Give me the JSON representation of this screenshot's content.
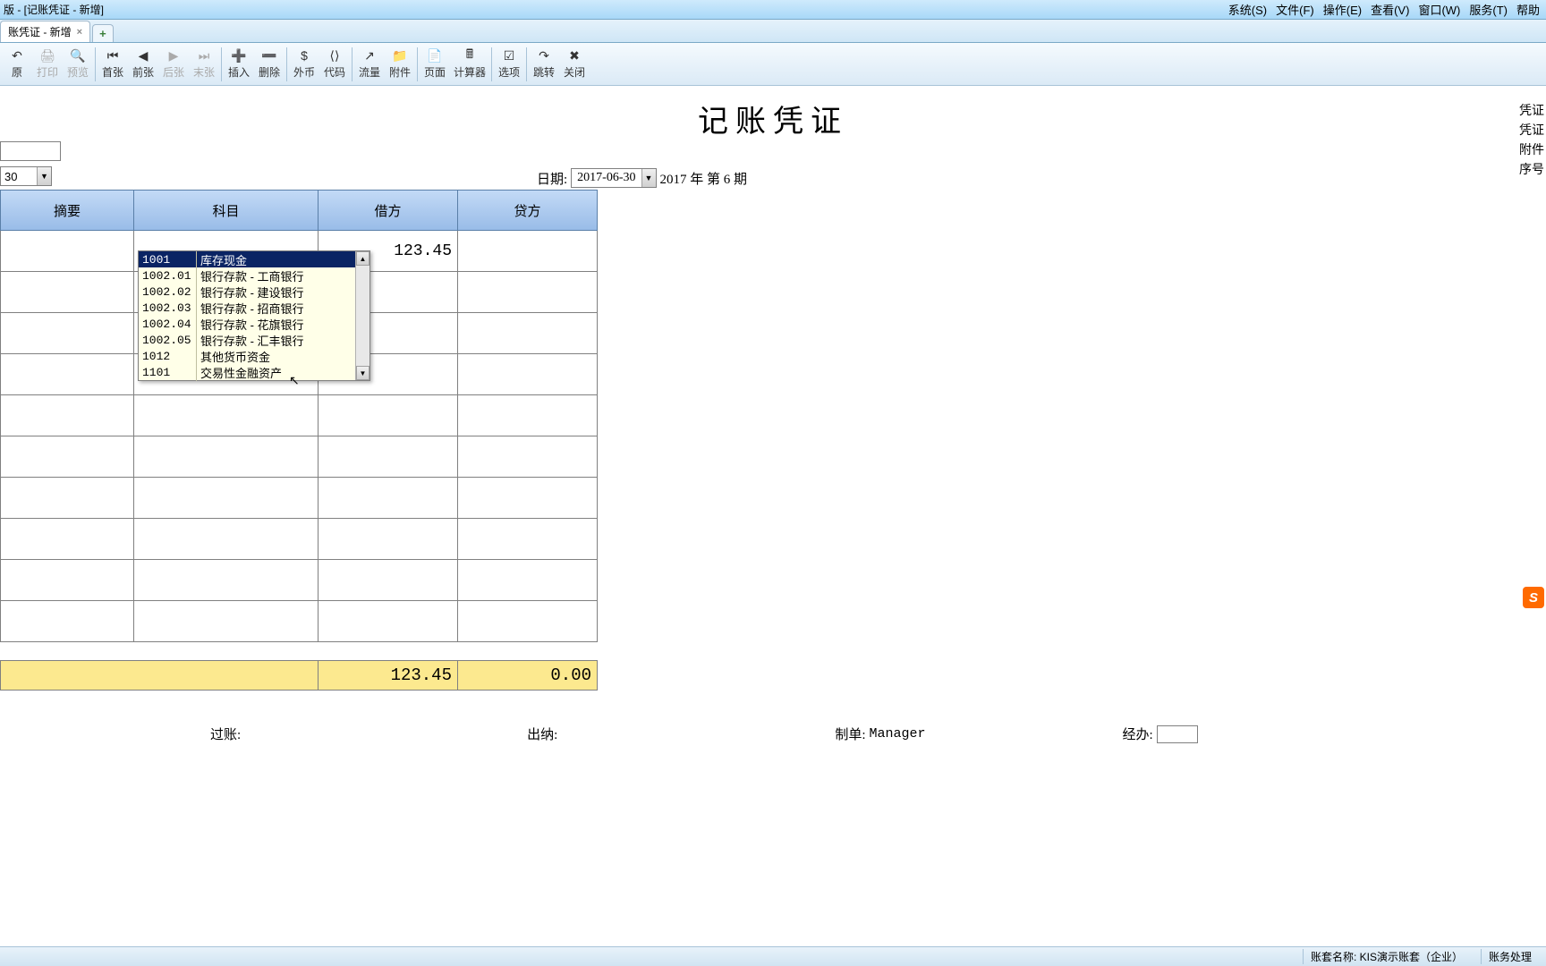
{
  "window": {
    "title": "版 - [记账凭证 - 新增]"
  },
  "menus": [
    {
      "label": "系统(S)"
    },
    {
      "label": "文件(F)"
    },
    {
      "label": "操作(E)"
    },
    {
      "label": "查看(V)"
    },
    {
      "label": "窗口(W)"
    },
    {
      "label": "服务(T)"
    },
    {
      "label": "帮助"
    }
  ],
  "tab": {
    "label": "账凭证 - 新增"
  },
  "toolbar": [
    {
      "label": "原",
      "icon": "↶",
      "group": 0
    },
    {
      "label": "打印",
      "icon": "🖨",
      "group": 0,
      "disabled": true
    },
    {
      "label": "预览",
      "icon": "🔍",
      "group": 0,
      "disabled": true
    },
    {
      "label": "首张",
      "icon": "⏮",
      "group": 1
    },
    {
      "label": "前张",
      "icon": "◀",
      "group": 1
    },
    {
      "label": "后张",
      "icon": "▶",
      "group": 1,
      "disabled": true
    },
    {
      "label": "末张",
      "icon": "⏭",
      "group": 1,
      "disabled": true
    },
    {
      "label": "插入",
      "icon": "➕",
      "group": 2
    },
    {
      "label": "删除",
      "icon": "➖",
      "group": 2
    },
    {
      "label": "外币",
      "icon": "$",
      "group": 3
    },
    {
      "label": "代码",
      "icon": "⟨⟩",
      "group": 3
    },
    {
      "label": "流量",
      "icon": "↗",
      "group": 4
    },
    {
      "label": "附件",
      "icon": "📁",
      "group": 4
    },
    {
      "label": "页面",
      "icon": "📄",
      "group": 5
    },
    {
      "label": "计算器",
      "icon": "🖩",
      "group": 5
    },
    {
      "label": "选项",
      "icon": "☑",
      "group": 6
    },
    {
      "label": "跳转",
      "icon": "↷",
      "group": 7
    },
    {
      "label": "关闭",
      "icon": "✖",
      "group": 7
    }
  ],
  "page": {
    "title": "记账凭证",
    "right_labels": [
      "凭证",
      "凭证",
      "附件",
      "序号"
    ],
    "number_select": "30",
    "date_label": "日期:",
    "date_value": "2017-06-30",
    "period_text": "2017 年 第 6 期"
  },
  "grid": {
    "headers": {
      "summary": "摘要",
      "subject": "科目",
      "debit": "借方",
      "credit": "贷方"
    },
    "rows": [
      {
        "summary": "",
        "subject": "",
        "debit": "123.45",
        "credit": ""
      },
      {
        "summary": "",
        "subject": "",
        "debit": "",
        "credit": ""
      },
      {
        "summary": "",
        "subject": "",
        "debit": "",
        "credit": ""
      },
      {
        "summary": "",
        "subject": "",
        "debit": "",
        "credit": ""
      },
      {
        "summary": "",
        "subject": "",
        "debit": "",
        "credit": ""
      },
      {
        "summary": "",
        "subject": "",
        "debit": "",
        "credit": ""
      },
      {
        "summary": "",
        "subject": "",
        "debit": "",
        "credit": ""
      },
      {
        "summary": "",
        "subject": "",
        "debit": "",
        "credit": ""
      },
      {
        "summary": "",
        "subject": "",
        "debit": "",
        "credit": ""
      },
      {
        "summary": "",
        "subject": "",
        "debit": "",
        "credit": ""
      }
    ],
    "totals": {
      "debit": "123.45",
      "credit": "0.00"
    }
  },
  "dropdown": {
    "items": [
      {
        "code": "1001",
        "name": "库存现金",
        "selected": true
      },
      {
        "code": "1002.01",
        "name": "银行存款 - 工商银行"
      },
      {
        "code": "1002.02",
        "name": "银行存款 - 建设银行"
      },
      {
        "code": "1002.03",
        "name": "银行存款 - 招商银行"
      },
      {
        "code": "1002.04",
        "name": "银行存款 - 花旗银行"
      },
      {
        "code": "1002.05",
        "name": "银行存款 - 汇丰银行"
      },
      {
        "code": "1012",
        "name": "其他货币资金"
      },
      {
        "code": "1101",
        "name": "交易性金融资产"
      }
    ]
  },
  "footer": {
    "post": "过账:",
    "cashier": "出纳:",
    "maker_label": "制单:",
    "maker_value": "Manager",
    "handler": "经办:"
  },
  "status": {
    "account_label": "账套名称:",
    "account_value": "KIS演示账套（企业）",
    "module": "账务处理"
  },
  "ime": "S"
}
